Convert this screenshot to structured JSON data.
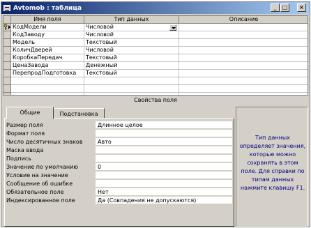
{
  "window": {
    "title": "Avtomob : таблица",
    "minimize_label": "_",
    "maximize_label": "□",
    "close_label": "×"
  },
  "grid": {
    "columns": [
      "Имя поля",
      "Тип данных",
      "Описание"
    ],
    "rows": [
      {
        "name": "КодМодели",
        "type": "Числовой",
        "desc": ""
      },
      {
        "name": "КодЗаводу",
        "type": "Числовой",
        "desc": ""
      },
      {
        "name": "Модель",
        "type": "Текстовый",
        "desc": ""
      },
      {
        "name": "КоличДверей",
        "type": "Числовой",
        "desc": ""
      },
      {
        "name": "КоробкаПередач",
        "type": "Текстовый",
        "desc": ""
      },
      {
        "name": "ЦенаЗавода",
        "type": "Денежный",
        "desc": ""
      },
      {
        "name": "ПерепродПодготовка",
        "type": "Текстовый",
        "desc": ""
      }
    ],
    "empty_rows": 3,
    "selected_row": 0
  },
  "properties": {
    "title": "Свойства поля",
    "tabs": [
      "Общие",
      "Подстановка"
    ],
    "active_tab": 0,
    "rows": [
      {
        "label": "Размер поля",
        "value": "Длинное целое"
      },
      {
        "label": "Формат поля",
        "value": ""
      },
      {
        "label": "Число десятичных знаков",
        "value": "Авто"
      },
      {
        "label": "Маска ввода",
        "value": ""
      },
      {
        "label": "Подпись",
        "value": ""
      },
      {
        "label": "Значение по умолчанию",
        "value": "0"
      },
      {
        "label": "Условие на значение",
        "value": ""
      },
      {
        "label": "Сообщение об ошибке",
        "value": ""
      },
      {
        "label": "Обязательное поле",
        "value": "Нет"
      },
      {
        "label": "Индексированное поле",
        "value": "Да (Совпадения не допускаются)"
      }
    ]
  },
  "help": {
    "text": "Тип данных определяет значения, которые можно сохранять в этом поле. Для справки по типам данных нажмите клавишу F1."
  },
  "colors": {
    "title_gradient_start": "#0a246a",
    "title_gradient_end": "#a6caf0",
    "help_text": "#000080",
    "face": "#d4d0c8"
  },
  "icons": {
    "primary_key": "key-icon",
    "current_row": "row-pointer-icon",
    "dropdown": "chevron-down-icon",
    "window": "table-icon"
  }
}
